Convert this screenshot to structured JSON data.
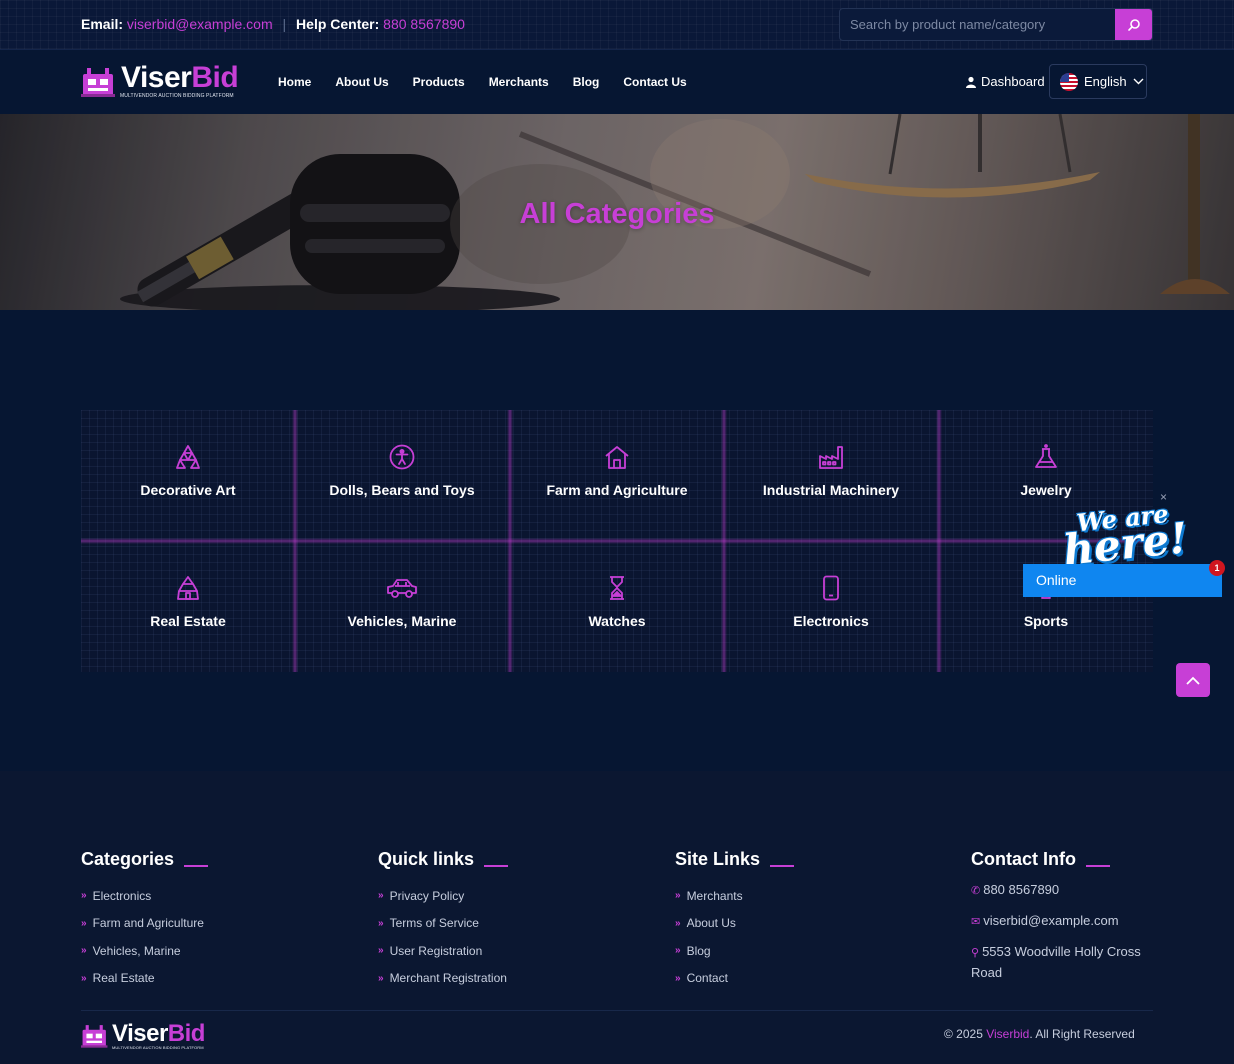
{
  "topbar": {
    "email_label": "Email:",
    "email": "viserbid@example.com",
    "help_label": "Help Center:",
    "phone": "880 8567890",
    "search_placeholder": "Search by product name/category",
    "search_icon": "search-icon"
  },
  "brand": {
    "word_white": "Viser",
    "word_accent": "Bid",
    "tagline": "MULTIVENDOR AUCTION BIDDING PLATFORM",
    "accent_color": "#c73fd6",
    "background": "#061632"
  },
  "nav": {
    "items": [
      "Home",
      "About Us",
      "Products",
      "Merchants",
      "Blog",
      "Contact Us"
    ],
    "dashboard": "Dashboard",
    "language": "English"
  },
  "banner": {
    "title": "All Categories"
  },
  "categories": [
    {
      "label": "Decorative Art",
      "icon": "decorative-art-icon"
    },
    {
      "label": "Dolls, Bears and Toys",
      "icon": "toys-icon"
    },
    {
      "label": "Farm and Agriculture",
      "icon": "home-icon"
    },
    {
      "label": "Industrial Machinery",
      "icon": "factory-icon"
    },
    {
      "label": "Jewelry",
      "icon": "flask-icon"
    },
    {
      "label": "Real Estate",
      "icon": "building-icon"
    },
    {
      "label": "Vehicles, Marine",
      "icon": "car-icon"
    },
    {
      "label": "Watches",
      "icon": "hourglass-icon"
    },
    {
      "label": "Electronics",
      "icon": "mobile-icon"
    },
    {
      "label": "Sports",
      "icon": "sports-icon"
    }
  ],
  "chat": {
    "close": "×",
    "we_are": "We are",
    "here": "here!",
    "status": "Online",
    "badge": "1"
  },
  "footer": {
    "categories_title": "Categories",
    "categories": [
      "Electronics",
      "Farm and Agriculture",
      "Vehicles, Marine",
      "Real Estate"
    ],
    "quick_title": "Quick links",
    "quick": [
      "Privacy Policy",
      "Terms of Service",
      "User Registration",
      "Merchant Registration"
    ],
    "site_title": "Site Links",
    "site": [
      "Merchants",
      "About Us",
      "Blog",
      "Contact"
    ],
    "contact_title": "Contact Info",
    "phone": "880 8567890",
    "email": "viserbid@example.com",
    "address": "5553 Woodville Holly Cross Road",
    "copyright_prefix": "© 2025",
    "copyright_brand": "Viserbid",
    "copyright_suffix": ". All Right Reserved"
  }
}
